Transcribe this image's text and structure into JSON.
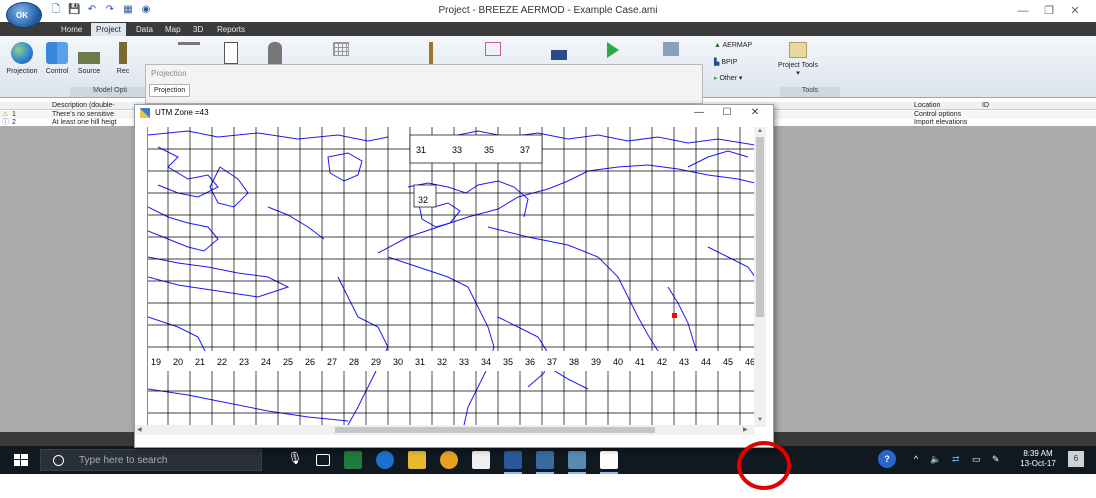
{
  "window": {
    "title": "Project - BREEZE AERMOD - Example Case.ami",
    "logo_text": "OK",
    "minimize": "—",
    "restore": "❐",
    "close": "✕"
  },
  "ribbon": {
    "tabs": [
      "Home",
      "Project",
      "Data",
      "Map",
      "3D",
      "Reports"
    ],
    "active_tab": "Project",
    "buttons": {
      "projection": "Projection",
      "control": "Control",
      "source": "Source",
      "rec": "Rec"
    },
    "group_model_options": "Model Opti",
    "small_buttons": {
      "aermap": "AERMAP",
      "bpip": "BPIP",
      "other": "Other ▾",
      "project_tools": "Project Tools ▾"
    },
    "group_tools": "Tools"
  },
  "projection_popup": {
    "title": "Projection",
    "tab": "Projection"
  },
  "messages": {
    "headers": {
      "description": "Description (double-",
      "location": "Location",
      "id": "ID"
    },
    "rows": [
      {
        "num": "1",
        "icon": "warning-icon",
        "description": "There's no sensitive",
        "location": "Control options"
      },
      {
        "num": "2",
        "icon": "info-icon",
        "description": "At least one hill heigt",
        "location": "Import elevations"
      }
    ]
  },
  "utm_window": {
    "title": "UTM  Zone =43",
    "minimize": "—",
    "maximize": "☐",
    "close": "✕",
    "top_zone_labels": [
      "31",
      "33",
      "35",
      "37"
    ],
    "mid_zone_label": "32",
    "bottom_zone_labels": [
      "19",
      "20",
      "21",
      "22",
      "23",
      "24",
      "25",
      "26",
      "27",
      "28",
      "29",
      "30",
      "31",
      "32",
      "33",
      "34",
      "35",
      "36",
      "37",
      "38",
      "39",
      "40",
      "41",
      "42",
      "43",
      "44",
      "45",
      "46"
    ]
  },
  "taskbar": {
    "search_placeholder": "Type here to search",
    "time": "8:39 AM",
    "date": "13-Oct-17"
  },
  "colors": {
    "coastline": "#1a1aff",
    "grid": "#000000",
    "marker": "#ff0000",
    "annotation": "#e00000"
  }
}
